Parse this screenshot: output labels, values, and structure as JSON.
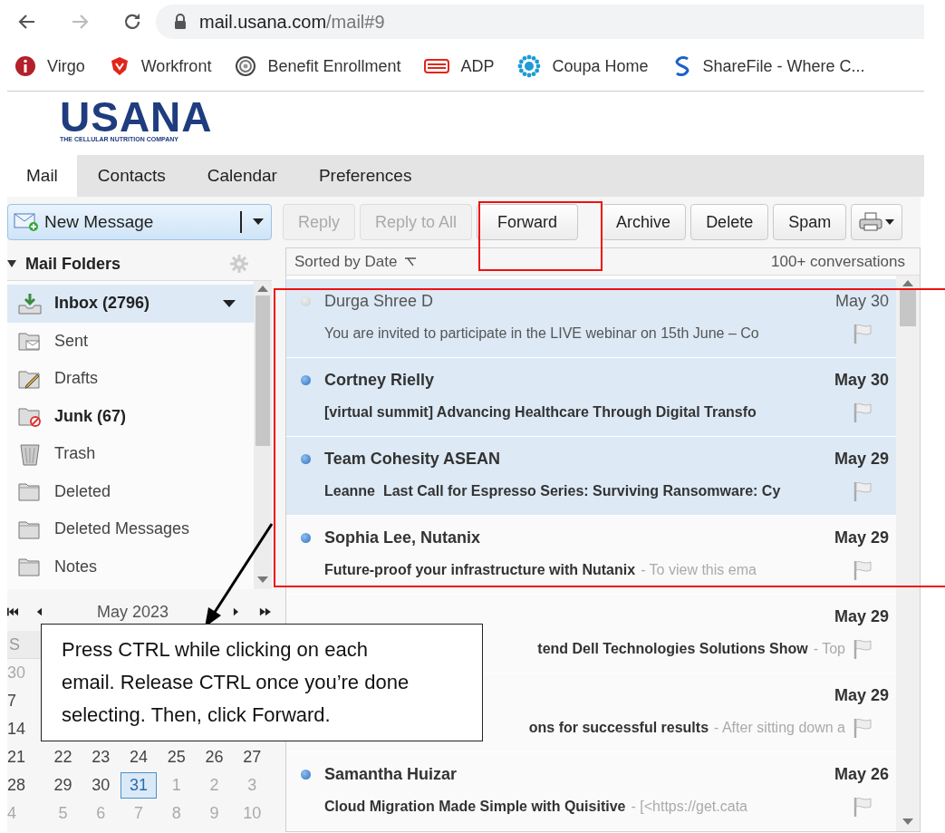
{
  "browser": {
    "nav": [
      {
        "kind": "back",
        "disabled": false
      },
      {
        "kind": "forward",
        "disabled": true
      },
      {
        "kind": "reload",
        "disabled": false
      }
    ],
    "url": {
      "host": "mail.usana.com",
      "path": "/mail#9"
    },
    "bookmarks": [
      {
        "kind": "info",
        "label": "Virgo"
      },
      {
        "kind": "shield",
        "label": "Workfront"
      },
      {
        "kind": "ring",
        "label": "Benefit Enrollment"
      },
      {
        "kind": "stripes",
        "label": "ADP"
      },
      {
        "kind": "starburst",
        "label": "Coupa Home"
      },
      {
        "kind": "swirl",
        "label": "ShareFile - Where C..."
      }
    ]
  },
  "logo": {
    "name": "USANA",
    "tagline": "THE CELLULAR NUTRITION COMPANY"
  },
  "tabs": [
    {
      "label": "Mail",
      "selected": true
    },
    {
      "label": "Contacts",
      "selected": false
    },
    {
      "label": "Calendar",
      "selected": false
    },
    {
      "label": "Preferences",
      "selected": false
    }
  ],
  "toolbar": {
    "new_message": "New Message",
    "buttons": [
      {
        "label": "Reply",
        "disabled": true
      },
      {
        "label": "Reply to All",
        "disabled": true
      },
      {
        "label": "Forward",
        "disabled": false
      },
      {
        "label": "Archive",
        "disabled": false
      },
      {
        "label": "Delete",
        "disabled": false
      },
      {
        "label": "Spam",
        "disabled": false
      }
    ]
  },
  "folders": {
    "title": "Mail Folders",
    "items": [
      {
        "kind": "inbox",
        "label": "Inbox (2796)",
        "bold": true,
        "selected": true
      },
      {
        "kind": "sent",
        "label": "Sent",
        "bold": false,
        "selected": false
      },
      {
        "kind": "drafts",
        "label": "Drafts",
        "bold": false,
        "selected": false
      },
      {
        "kind": "junk",
        "label": "Junk (67)",
        "bold": true,
        "selected": false
      },
      {
        "kind": "trash",
        "label": "Trash",
        "bold": false,
        "selected": false
      },
      {
        "kind": "folder",
        "label": "Deleted",
        "bold": false,
        "selected": false
      },
      {
        "kind": "folder",
        "label": "Deleted Messages",
        "bold": false,
        "selected": false
      },
      {
        "kind": "folder",
        "label": "Notes",
        "bold": false,
        "selected": false
      }
    ]
  },
  "calendar": {
    "month": "May 2023",
    "weekdays": [
      "S"
    ],
    "weeks": [
      [
        {
          "day": "30",
          "muted": true,
          "selected": false
        }
      ],
      [
        {
          "day": "7",
          "muted": false,
          "selected": false
        }
      ],
      [
        {
          "day": "14",
          "muted": false,
          "selected": false
        }
      ],
      [
        {
          "day": "21",
          "muted": false,
          "selected": false
        },
        {
          "day": "22",
          "muted": false,
          "selected": false
        },
        {
          "day": "23",
          "muted": false,
          "selected": false
        },
        {
          "day": "24",
          "muted": false,
          "selected": false
        },
        {
          "day": "25",
          "muted": false,
          "selected": false
        },
        {
          "day": "26",
          "muted": false,
          "selected": false
        },
        {
          "day": "27",
          "muted": false,
          "selected": false
        }
      ],
      [
        {
          "day": "28",
          "muted": false,
          "selected": false
        },
        {
          "day": "29",
          "muted": false,
          "selected": false
        },
        {
          "day": "30",
          "muted": false,
          "selected": false
        },
        {
          "day": "31",
          "muted": false,
          "selected": true
        },
        {
          "day": "1",
          "muted": true,
          "selected": false
        },
        {
          "day": "2",
          "muted": true,
          "selected": false
        },
        {
          "day": "3",
          "muted": true,
          "selected": false
        }
      ],
      [
        {
          "day": "4",
          "muted": true,
          "selected": false
        },
        {
          "day": "5",
          "muted": true,
          "selected": false
        },
        {
          "day": "6",
          "muted": true,
          "selected": false
        },
        {
          "day": "7",
          "muted": true,
          "selected": false
        },
        {
          "day": "8",
          "muted": true,
          "selected": false
        },
        {
          "day": "9",
          "muted": true,
          "selected": false
        },
        {
          "day": "10",
          "muted": true,
          "selected": false
        }
      ]
    ]
  },
  "list": {
    "sort_label": "Sorted by Date",
    "count": "100+ conversations",
    "rows": [
      {
        "sender": "Durga Shree D",
        "date": "May 30",
        "subject": "You are invited to participate in the LIVE webinar on 15th June – Co",
        "unread": false,
        "selected": true
      },
      {
        "sender": "Cortney Rielly",
        "date": "May 30",
        "subject": "[virtual summit] Advancing Healthcare Through Digital Transfo",
        "unread": true,
        "selected": true
      },
      {
        "sender": "Team Cohesity ASEAN",
        "date": "May 29",
        "subject": "Leanne  Last Call for Espresso Series: Surviving Ransomware: Cy",
        "unread": true,
        "selected": true
      },
      {
        "sender": "Sophia Lee, Nutanix",
        "date": "May 29",
        "subject": "Future-proof your infrastructure with Nutanix",
        "preview": "- To view this ema",
        "unread": true,
        "selected": false
      },
      {
        "date": "May 29",
        "subject": "tend Dell Technologies Solutions Show",
        "preview": "- Top",
        "unread": true,
        "selected": false
      },
      {
        "date": "May 29",
        "subject": "ons for successful results",
        "preview": "- After sitting down a",
        "unread": true,
        "selected": false
      },
      {
        "sender": "Samantha Huizar",
        "date": "May 26",
        "subject": "Cloud Migration Made Simple with Quisitive",
        "preview": "- [<https://get.cata",
        "unread": true,
        "selected": false
      }
    ]
  },
  "callout": {
    "text": "Press CTRL while clicking on each email. Release CTRL once you’re done selecting. Then, click Forward."
  }
}
